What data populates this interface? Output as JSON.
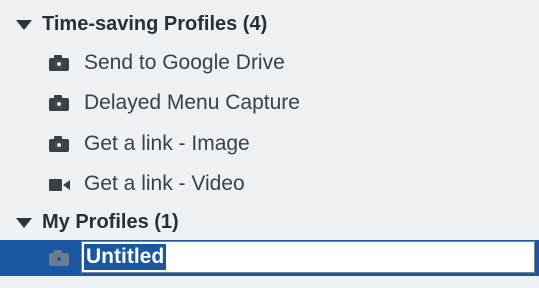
{
  "groups": [
    {
      "label": "Time-saving Profiles (4)",
      "items": [
        {
          "label": "Send to Google Drive",
          "icon": "camera-icon"
        },
        {
          "label": "Delayed Menu Capture",
          "icon": "camera-icon"
        },
        {
          "label": "Get a link - Image",
          "icon": "camera-icon"
        },
        {
          "label": "Get a link - Video",
          "icon": "video-icon"
        }
      ]
    },
    {
      "label": "My Profiles (1)",
      "items": [
        {
          "label": "Untitled",
          "icon": "camera-icon",
          "editing": true
        }
      ]
    }
  ],
  "colors": {
    "background": "#eef1f4",
    "selection": "#1a57a0",
    "text": "#2a2f36"
  }
}
